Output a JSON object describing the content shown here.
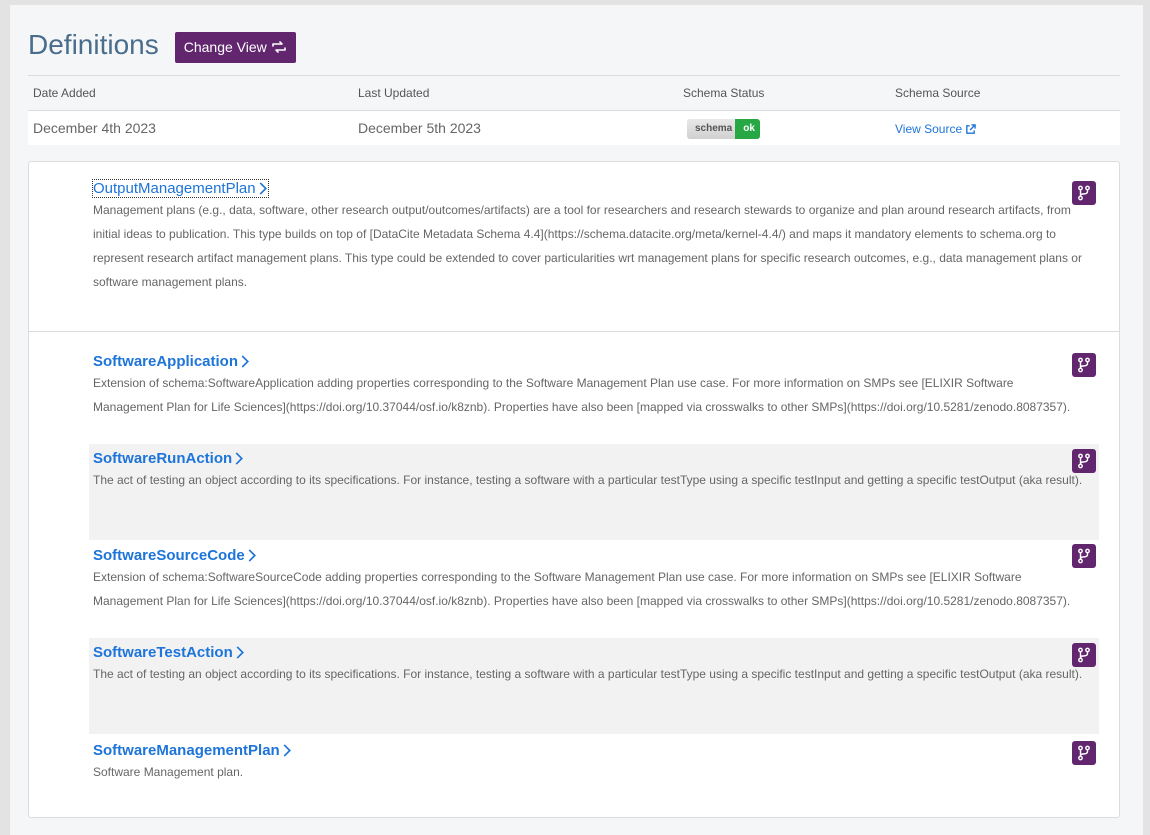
{
  "page": {
    "title": "Definitions",
    "change_view_label": "Change View"
  },
  "meta": {
    "headers": {
      "date_added": "Date Added",
      "last_updated": "Last Updated",
      "schema_status": "Schema Status",
      "schema_source": "Schema Source"
    },
    "date_added": "December 4th 2023",
    "last_updated": "December 5th 2023",
    "status_badge": {
      "left": "schema",
      "right": "ok"
    },
    "view_source_label": "View Source"
  },
  "definitions": [
    {
      "title": "OutputManagementPlan",
      "description": "Management plans (e.g., data, software, other research output/outcomes/artifacts) are a tool for researchers and research stewards to organize and plan around research artifacts, from initial ideas to publication. This type builds on top of [DataCite Metadata Schema 4.4](https://schema.datacite.org/meta/kernel-4.4/) and maps it mandatory elements to schema.org to represent research artifact management plans. This type could be extended to cover particularities wrt management plans for specific research outcomes, e.g., data management plans or software management plans."
    },
    {
      "title": "SoftwareApplication",
      "description": "Extension of schema:SoftwareApplication adding properties corresponding to the Software Management Plan use case. For more information on SMPs see [ELIXIR Software Management Plan for Life Sciences](https://doi.org/10.37044/osf.io/k8znb). Properties have also been [mapped via crosswalks to other SMPs](https://doi.org/10.5281/zenodo.8087357)."
    },
    {
      "title": "SoftwareRunAction",
      "description": "The act of testing an object according to its specifications. For instance, testing a software with a particular testType using a specific testInput and getting a specific testOutput (aka result)."
    },
    {
      "title": "SoftwareSourceCode",
      "description": "Extension of schema:SoftwareSourceCode adding properties corresponding to the Software Management Plan use case. For more information on SMPs see [ELIXIR Software Management Plan for Life Sciences](https://doi.org/10.37044/osf.io/k8znb). Properties have also been [mapped via crosswalks to other SMPs](https://doi.org/10.5281/zenodo.8087357)."
    },
    {
      "title": "SoftwareTestAction",
      "description": "The act of testing an object according to its specifications. For instance, testing a software with a particular testType using a specific testInput and getting a specific testOutput (aka result)."
    },
    {
      "title": "SoftwareManagementPlan",
      "description": "Software Management plan."
    }
  ],
  "colors": {
    "accent_purple": "#62266f",
    "link_blue": "#1d74d9",
    "ok_green": "#28a745"
  },
  "icons": {
    "change_view": "refresh-icon",
    "view_source": "external-link-icon",
    "chevron": "chevron-right-icon",
    "fork": "code-fork-icon"
  }
}
